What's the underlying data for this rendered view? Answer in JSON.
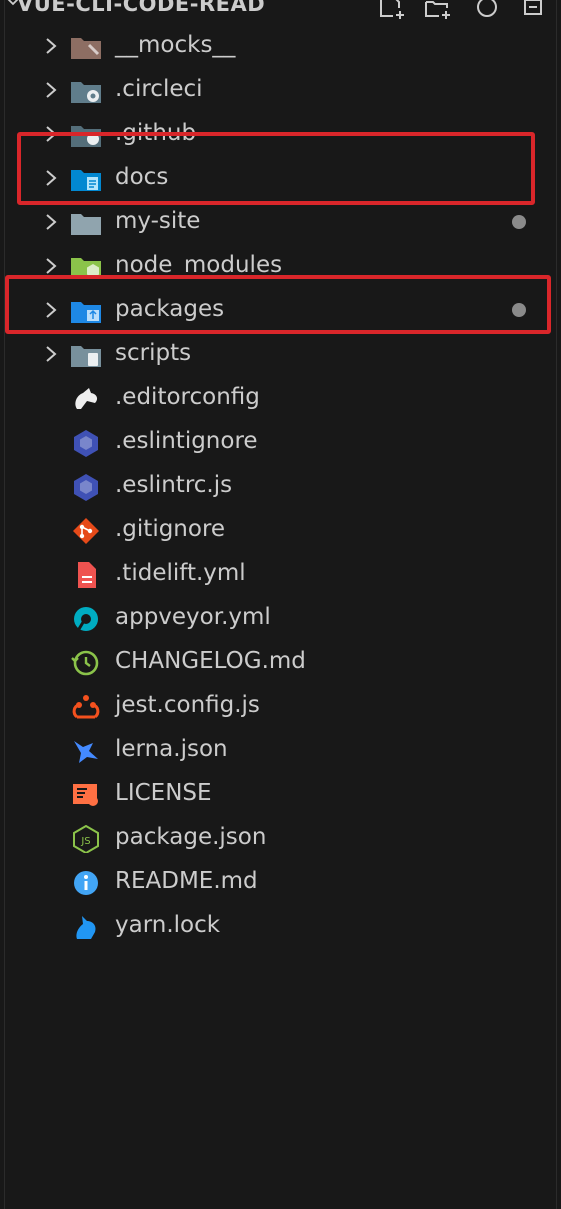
{
  "explorer": {
    "title": "VUE-CLI-CODE-READ",
    "header_actions": [
      "new-file-icon",
      "new-folder-icon",
      "refresh-icon",
      "collapse-all-icon"
    ]
  },
  "tree": [
    {
      "label": "__mocks__",
      "type": "folder",
      "icon": "folder-mocks-icon",
      "modified": false
    },
    {
      "label": ".circleci",
      "type": "folder",
      "icon": "folder-circleci-icon",
      "modified": false
    },
    {
      "label": ".github",
      "type": "folder",
      "icon": "folder-github-icon",
      "modified": false
    },
    {
      "label": "docs",
      "type": "folder",
      "icon": "folder-docs-icon",
      "modified": false,
      "highlighted": true
    },
    {
      "label": "my-site",
      "type": "folder",
      "icon": "folder-icon",
      "modified": true
    },
    {
      "label": "node_modules",
      "type": "folder",
      "icon": "folder-node-icon",
      "modified": false
    },
    {
      "label": "packages",
      "type": "folder",
      "icon": "folder-packages-icon",
      "modified": true,
      "highlighted": true
    },
    {
      "label": "scripts",
      "type": "folder",
      "icon": "folder-scripts-icon",
      "modified": false
    },
    {
      "label": ".editorconfig",
      "type": "file",
      "icon": "editorconfig-icon"
    },
    {
      "label": ".eslintignore",
      "type": "file",
      "icon": "eslint-icon"
    },
    {
      "label": ".eslintrc.js",
      "type": "file",
      "icon": "eslint-icon"
    },
    {
      "label": ".gitignore",
      "type": "file",
      "icon": "git-icon"
    },
    {
      "label": ".tidelift.yml",
      "type": "file",
      "icon": "tidelift-icon"
    },
    {
      "label": "appveyor.yml",
      "type": "file",
      "icon": "appveyor-icon"
    },
    {
      "label": "CHANGELOG.md",
      "type": "file",
      "icon": "changelog-icon"
    },
    {
      "label": "jest.config.js",
      "type": "file",
      "icon": "jest-icon"
    },
    {
      "label": "lerna.json",
      "type": "file",
      "icon": "lerna-icon"
    },
    {
      "label": "LICENSE",
      "type": "file",
      "icon": "license-icon"
    },
    {
      "label": "package.json",
      "type": "file",
      "icon": "nodejs-icon"
    },
    {
      "label": "README.md",
      "type": "file",
      "icon": "readme-icon"
    },
    {
      "label": "yarn.lock",
      "type": "file",
      "icon": "yarn-icon"
    }
  ],
  "colors": {
    "background": "#181818",
    "text": "#cccccc",
    "highlight_border": "#d9262a",
    "modified_dot": "#8a8a8a"
  }
}
